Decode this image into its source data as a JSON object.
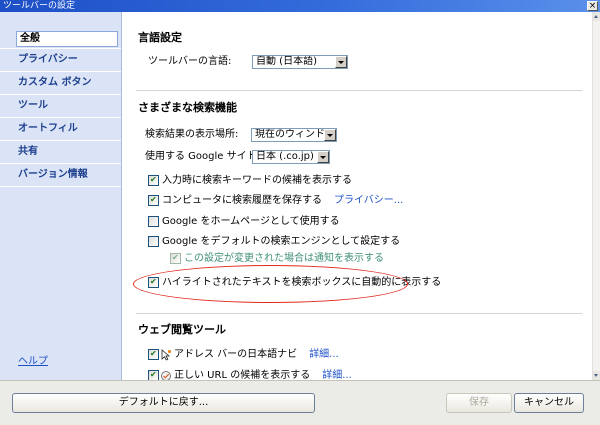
{
  "window": {
    "title": "ツールバーの設定",
    "close_glyph": "×"
  },
  "sidebar": {
    "items": [
      {
        "label": "全般",
        "selected": true
      },
      {
        "label": "プライバシー",
        "selected": false
      },
      {
        "label": "カスタム ボタン",
        "selected": false
      },
      {
        "label": "ツール",
        "selected": false
      },
      {
        "label": "オートフィル",
        "selected": false
      },
      {
        "label": "共有",
        "selected": false
      },
      {
        "label": "バージョン情報",
        "selected": false
      }
    ],
    "help_link": "ヘルプ"
  },
  "main": {
    "language_section": {
      "heading": "言語設定",
      "toolbar_language_label": "ツールバーの言語:",
      "toolbar_language_value": "自動 (日本語)"
    },
    "search_section": {
      "heading": "さまざまな検索機能",
      "results_location_label": "検索結果の表示場所:",
      "results_location_value": "現在のウィンドウ",
      "google_site_label": "使用する Google サイト:",
      "google_site_value": "日本 (.co.jp)",
      "options": [
        {
          "label": "入力時に検索キーワードの候補を表示する",
          "checked": true
        },
        {
          "label": "コンピュータに検索履歴を保存する",
          "checked": true,
          "link": "プライバシー..."
        },
        {
          "label": "Google をホームページとして使用する",
          "checked": false
        },
        {
          "label": "Google をデフォルトの検索エンジンとして設定する",
          "checked": false
        },
        {
          "label": "この設定が変更された場合は通知を表示する",
          "checked": true,
          "disabled": true
        },
        {
          "label": "ハイライトされたテキストを検索ボックスに自動的に表示する",
          "checked": true,
          "highlighted": true
        }
      ]
    },
    "browsing_section": {
      "heading": "ウェブ閲覧ツール",
      "options": [
        {
          "label": "アドレス バーの日本語ナビ",
          "checked": true,
          "icon": "address-bar-navi-icon",
          "link": "詳細..."
        },
        {
          "label": "正しい URL の候補を表示する",
          "checked": true,
          "icon": "url-suggest-icon",
          "link": "詳細..."
        }
      ]
    }
  },
  "footer": {
    "reset_button": "デフォルトに戻す...",
    "save_button": "保存",
    "save_disabled": true,
    "cancel_button": "キャンセル"
  },
  "colors": {
    "title_bar": "#346cdc",
    "sidebar_bg": "#dbe4f6",
    "sidebar_text": "#1c3f8e",
    "link": "#1a4fc8",
    "highlight_ellipse": "#e0281e"
  }
}
